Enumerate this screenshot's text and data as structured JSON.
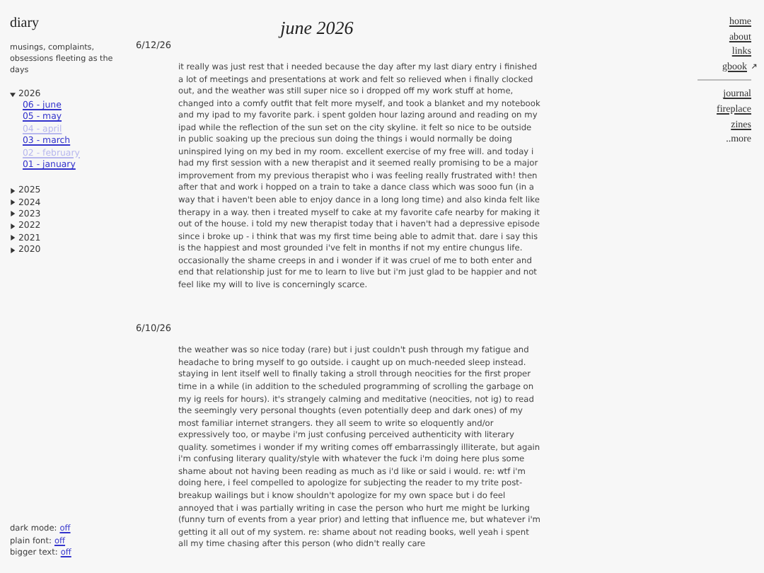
{
  "site_title": "diary",
  "tagline": "musings, complaints, obsessions fleeting as the days",
  "archive": [
    {
      "year": "2026",
      "expanded": true,
      "months": [
        {
          "label": "06 - june",
          "disabled": false
        },
        {
          "label": "05 - may",
          "disabled": false
        },
        {
          "label": "04 - april",
          "disabled": true
        },
        {
          "label": "03 - march",
          "disabled": false
        },
        {
          "label": "02 - february",
          "disabled": true
        },
        {
          "label": "01 - january",
          "disabled": false
        }
      ]
    },
    {
      "year": "2025",
      "expanded": false
    },
    {
      "year": "2024",
      "expanded": false
    },
    {
      "year": "2023",
      "expanded": false
    },
    {
      "year": "2022",
      "expanded": false
    },
    {
      "year": "2021",
      "expanded": false
    },
    {
      "year": "2020",
      "expanded": false
    }
  ],
  "settings": [
    {
      "label": "dark mode:",
      "value": "off"
    },
    {
      "label": "plain font:",
      "value": "off"
    },
    {
      "label": "bigger text:",
      "value": "off"
    }
  ],
  "page_title": "june 2026",
  "entries": [
    {
      "date": "6/12/26",
      "text": "it really was just rest that i needed because the day after my last diary entry i finished a lot of meetings and presentations at work and felt so relieved when i finally clocked out, and the weather was still super nice so i dropped off my work stuff at home, changed into a comfy outfit that felt more myself, and took a blanket and my notebook and my ipad to my favorite park. i spent golden hour lazing around and reading on my ipad while the reflection of the sun set on the city skyline. it felt so nice to be outside in public soaking up the precious sun doing the things i would normally be doing uninspired lying on my bed in my room. excellent exercise of my free will. and today i had my first session with a new therapist and it seemed really promising to be a major improvement from my previous therapist who i was feeling really frustrated with! then after that and work i hopped on a train to take a dance class which was sooo fun (in a way that i haven't been able to enjoy dance in a long long time) and also kinda felt like therapy in a way. then i treated myself to cake at my favorite cafe nearby for making it out of the house. i told my new therapist today that i haven't had a depressive episode since i broke up - i think that was my first time being able to admit that. dare i say this is the happiest and most grounded i've felt in months if not my entire chungus life. occasionally the shame creeps in and i wonder if it was cruel of me to both enter and end that relationship just for me to learn to live but i'm just glad to be happier and not feel like my will to live is concerningly scarce."
    },
    {
      "date": "6/10/26",
      "text": "the weather was so nice today (rare) but i just couldn't push through my fatigue and headache to bring myself to go outside. i caught up on much-needed sleep instead. staying in lent itself well to finally taking a stroll through neocities for the first proper time in a while (in addition to the scheduled programming of scrolling the garbage on my ig reels for hours). it's strangely calming and meditative (neocities, not ig) to read the seemingly very personal thoughts (even potentially deep and dark ones) of my most familiar internet strangers. they all seem to write so eloquently and/or expressively too, or maybe i'm just confusing perceived authenticity with literary quality. sometimes i wonder if my writing comes off embarrassingly illiterate, but again i'm confusing literary quality/style with whatever the fuck i'm doing here plus some shame about not having been reading as much as i'd like or said i would. re: wtf i'm doing here, i feel compelled to apologize for subjecting the reader to my trite post-breakup wailings but i know shouldn't apologize for my own space but i do feel annoyed that i was partially writing in case the person who hurt me might be lurking (funny turn of events from a year prior) and letting that influence me, but whatever i'm getting it all out of my system. re: shame about not reading books, well yeah i spent all my time chasing after this person (who didn't really care"
    }
  ],
  "nav_primary": [
    {
      "label": "home",
      "external": false
    },
    {
      "label": "about",
      "external": false
    },
    {
      "label": "links",
      "external": false
    },
    {
      "label": "gbook",
      "external": true
    }
  ],
  "nav_secondary": [
    "journal",
    "fireplace",
    "zines",
    "..more"
  ]
}
